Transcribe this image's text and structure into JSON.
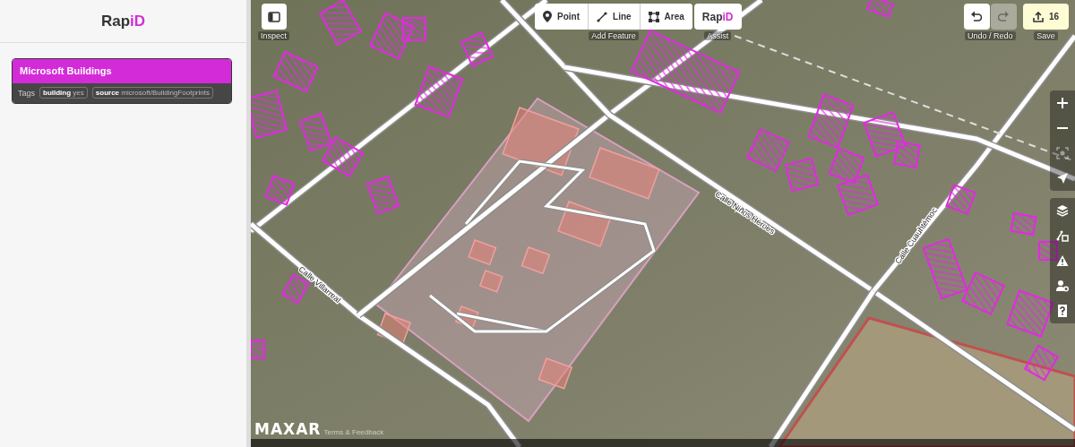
{
  "sidebar": {
    "logo": {
      "text": "Rap",
      "accent": "iD"
    },
    "dataset_card": {
      "title": "Microsoft Buildings",
      "tags_label": "Tags",
      "tags": [
        {
          "key": "building",
          "value": "yes"
        },
        {
          "key": "source",
          "value": "microsoft/BuildingFootprints"
        }
      ]
    }
  },
  "toolbar": {
    "inspect": {
      "label": "Inspect"
    },
    "add_feature": {
      "label": "Add Feature",
      "modes": [
        {
          "kind": "point",
          "label": "Point"
        },
        {
          "kind": "line",
          "label": "Line"
        },
        {
          "kind": "area",
          "label": "Area"
        }
      ]
    },
    "assist": {
      "logo": {
        "text": "Rap",
        "accent": "iD"
      },
      "label": "Assist"
    },
    "history": {
      "label": "Undo / Redo",
      "undo": {
        "disabled": false
      },
      "redo": {
        "disabled": true
      }
    },
    "save": {
      "label": "Save",
      "count": "16"
    }
  },
  "map_controls": [
    {
      "kind": "zoom-in",
      "disabled": false
    },
    {
      "kind": "zoom-out",
      "disabled": false
    },
    {
      "kind": "zoom-to-selection",
      "disabled": true
    },
    {
      "kind": "geolocate",
      "disabled": false
    },
    {
      "kind": "layers",
      "disabled": false
    },
    {
      "kind": "map-data",
      "disabled": false
    },
    {
      "kind": "issues",
      "disabled": false
    },
    {
      "kind": "preferences",
      "disabled": false
    },
    {
      "kind": "help",
      "disabled": false
    }
  ],
  "street_labels": [
    {
      "text": "Calle Villarreal"
    },
    {
      "text": "Calle Niños Héroes"
    },
    {
      "text": "Calle Cuauhtémoc"
    }
  ],
  "attribution": {
    "logo": "MAXAR",
    "link": "Terms & Feedback"
  }
}
